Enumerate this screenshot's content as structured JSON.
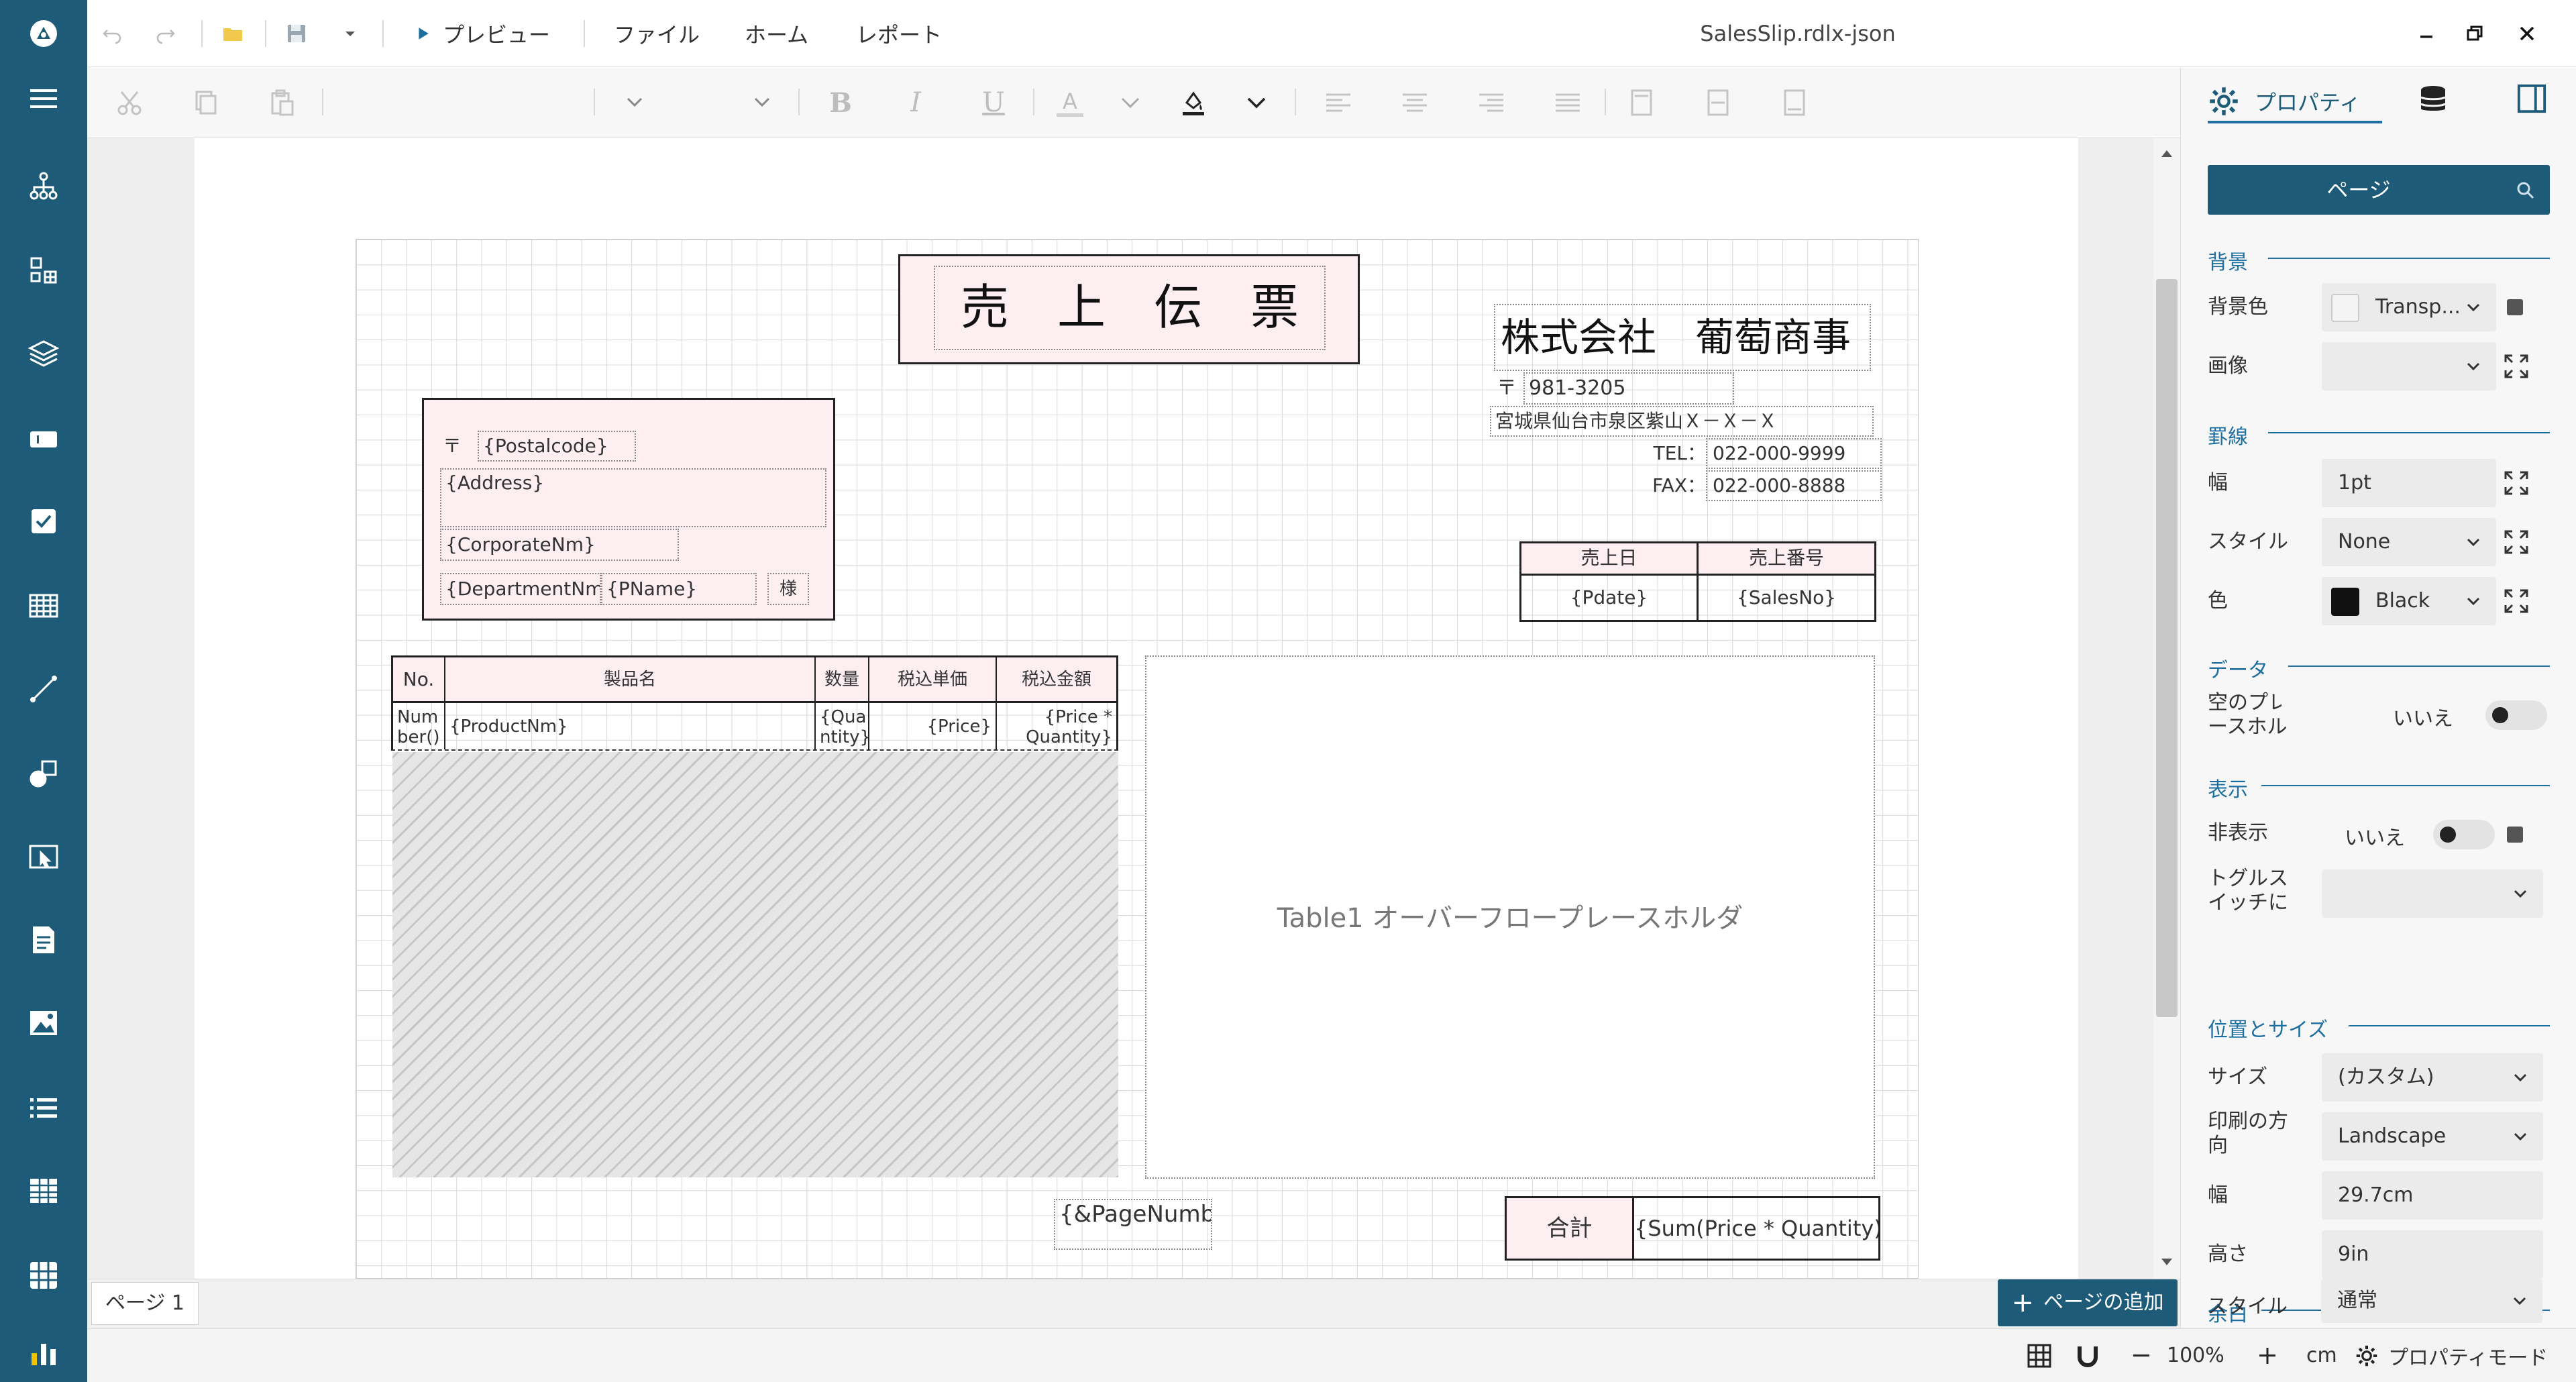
{
  "window": {
    "title": "SalesSlip.rdlx-json",
    "menu": {
      "preview": "プレビュー",
      "file": "ファイル",
      "home": "ホーム",
      "report": "レポート"
    }
  },
  "toolbar": {
    "bold": "B",
    "italic": "I",
    "underline": "U",
    "font_color": "A"
  },
  "props_header": {
    "tab_properties": "プロパティ",
    "search_selected": "ページ"
  },
  "props": {
    "sec_background": "背景",
    "bg_color_label": "背景色",
    "bg_color_value": "Transp...",
    "image_label": "画像",
    "image_value": "",
    "sec_border": "罫線",
    "width_label": "幅",
    "width_value": "1pt",
    "style_label": "スタイル",
    "style_value": "None",
    "color_label": "色",
    "color_value": "Black",
    "sec_data": "データ",
    "empty_placeholder_label": "空のプレースホル",
    "empty_placeholder_label2": "ースホル",
    "empty_placeholder_value": "いいえ",
    "sec_display": "表示",
    "hidden_label": "非表示",
    "hidden_value": "いいえ",
    "toggle_label_1": "トグルス",
    "toggle_label_2": "イッチに",
    "sec_position_size": "位置とサイズ",
    "size_label": "サイズ",
    "size_value": "(カスタム)",
    "orientation_label_1": "印刷の方",
    "orientation_label_2": "向",
    "orientation_value": "Landscape",
    "page_width_label": "幅",
    "page_width_value": "29.7cm",
    "page_height_label": "高さ",
    "page_height_value": "9in",
    "sec_margin": "余白",
    "margin_style_label": "スタイル",
    "margin_style_value": "通常"
  },
  "report": {
    "title": "売　上　伝　票",
    "company": "株式会社　葡萄商事",
    "postal_mark": "〒",
    "company_postal": "981-3205",
    "company_address": "宮城県仙台市泉区紫山Ｘ－Ｘ－Ｘ",
    "tel_label": "TEL：",
    "tel_value": "022-000-9999",
    "fax_label": "FAX：",
    "fax_value": "022-000-8888",
    "cust_postal": "{Postalcode}",
    "cust_address": "{Address}",
    "cust_corp": "{CorporateNm}",
    "cust_dept": "{DepartmentNm}",
    "cust_name": "{PName}",
    "cust_honorific": "様",
    "sales_date_header": "売上日",
    "sales_no_header": "売上番号",
    "sales_date_value": "{Pdate}",
    "sales_no_value": "{SalesNo}",
    "col_no": "No.",
    "col_product": "製品名",
    "col_qty": "数量",
    "col_price": "税込単価",
    "col_amount": "税込金額",
    "cell_no_1": "Num",
    "cell_no_2": "ber()",
    "cell_product": "{ProductNm}",
    "cell_qty_1": "{Qua",
    "cell_qty_2": "ntity}",
    "cell_price": "{Price}",
    "cell_amount_1": "{Price *",
    "cell_amount_2": "Quantity}",
    "overflow_placeholder": "Table1 オーバーフロープレースホルダ",
    "page_number": "{&PageNumbe",
    "total_label": "合計",
    "total_value": "{Sum(Price * Quantity)}"
  },
  "page_tabs": {
    "tab1": "ページ 1",
    "add_page": "ページの追加"
  },
  "status": {
    "zoom": "100%",
    "unit": "cm",
    "mode": "プロパティモード"
  },
  "colors": {
    "sidebar": "#1d5b78",
    "accent": "#1d6fa0",
    "pink": "#fdeef2",
    "add_button": "#1d5b78"
  }
}
